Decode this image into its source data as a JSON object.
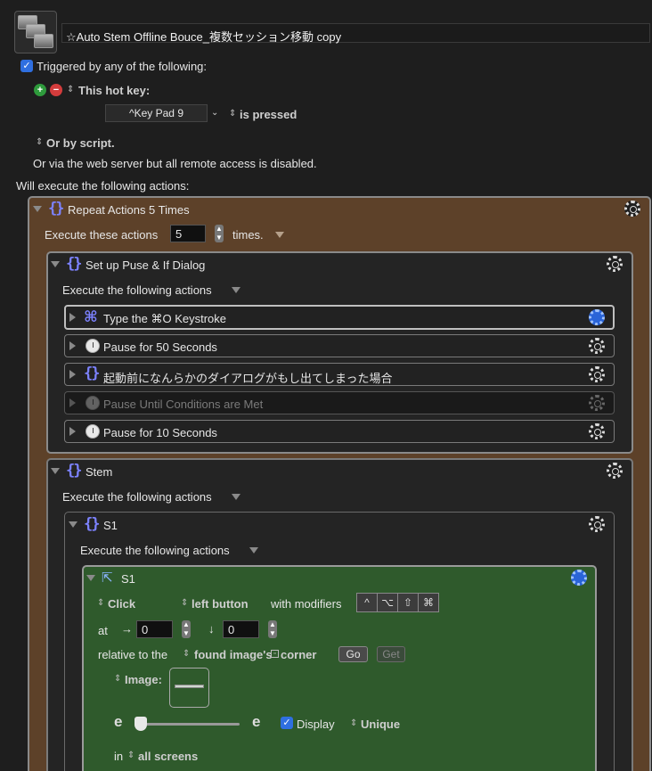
{
  "macro": {
    "name": "☆Auto Stem Offline Bouce_複数セッション移動 copy"
  },
  "triggers": {
    "header": "Triggered by any of the following:",
    "hotkey_label": "This hot key:",
    "hotkey_value": "^Key Pad 9",
    "hotkey_state": "is pressed",
    "script_label": "Or by script.",
    "web_server": "Or via the web server but all remote access is disabled."
  },
  "actions_header": "Will execute the following actions:",
  "repeat": {
    "title": "Repeat Actions 5 Times",
    "exec_label": "Execute these actions",
    "count": "5",
    "times_label": "times."
  },
  "group1": {
    "title": "Set up Puse & If Dialog",
    "exec_label": "Execute the following actions",
    "items": [
      {
        "label": "Type the ⌘O Keystroke",
        "icon": "command-icon"
      },
      {
        "label": "Pause for 50 Seconds",
        "icon": "clock-icon"
      },
      {
        "label": "起動前になんらかのダイアログがもし出てしまった場合",
        "icon": "braces-icon"
      },
      {
        "label": "Pause Until Conditions are Met",
        "icon": "clock-icon"
      },
      {
        "label": "Pause for 10 Seconds",
        "icon": "clock-icon"
      }
    ]
  },
  "stem": {
    "title": "Stem",
    "exec_label": "Execute the following actions"
  },
  "s1_group": {
    "title": "S1",
    "exec_label": "Execute the following actions"
  },
  "click_action": {
    "title": "S1",
    "click_label": "Click",
    "button_label": "left button",
    "modifiers_label": "with modifiers",
    "modifier_keys": [
      "^",
      "⌥",
      "⇧",
      "⌘"
    ],
    "at_label": "at",
    "x_value": "0",
    "y_value": "0",
    "relative_label": "relative to the",
    "relative_value": "found image's",
    "corner_label": "corner",
    "go_label": "Go",
    "get_label": "Get",
    "image_label": "Image:",
    "slider_left": "e",
    "slider_right": "e",
    "display_label": "Display",
    "unique_label": "Unique",
    "in_label": "in",
    "screens_value": "all screens"
  },
  "colors": {
    "repeat_bg": "#5d4129",
    "click_bg": "#2f5a2c",
    "accent": "#2f6fe0",
    "braces": "#7c82ff"
  }
}
